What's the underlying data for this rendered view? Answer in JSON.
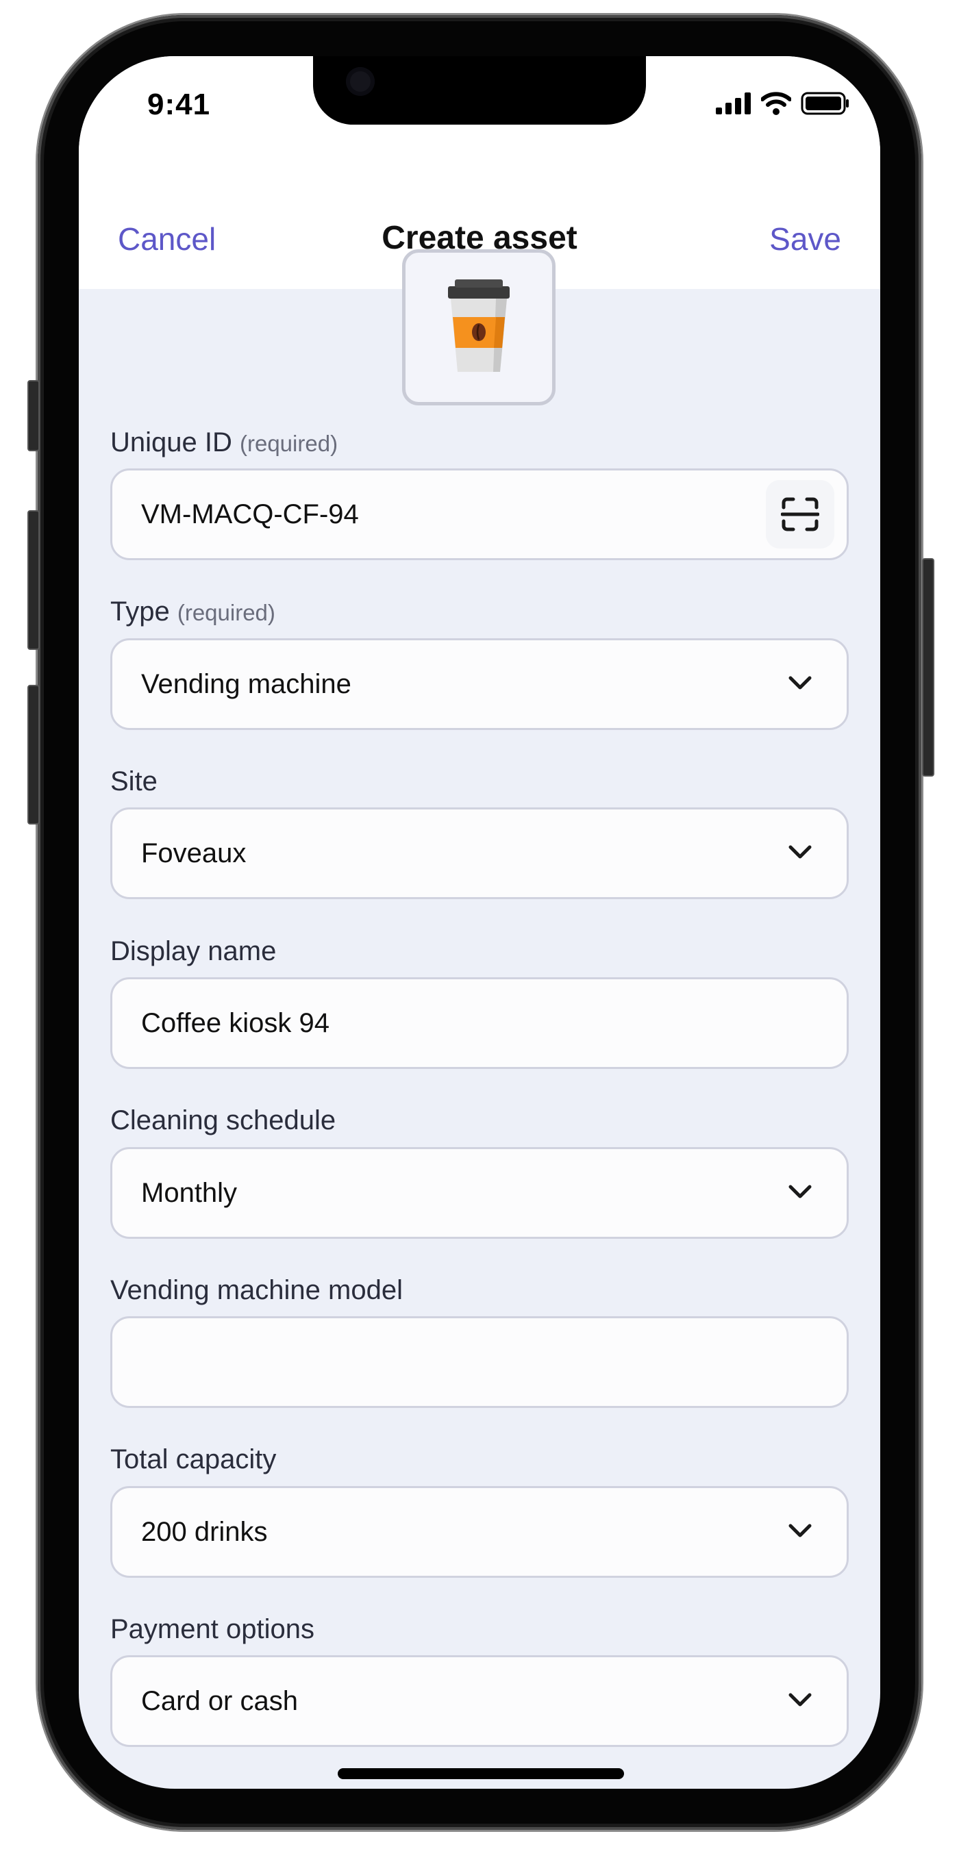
{
  "status_bar": {
    "time": "9:41"
  },
  "nav": {
    "cancel_label": "Cancel",
    "title": "Create asset",
    "save_label": "Save"
  },
  "asset_icon": "coffee-cup-icon",
  "fields": {
    "unique_id": {
      "label": "Unique ID",
      "hint": "(required)",
      "value": "VM-MACQ-CF-94"
    },
    "type": {
      "label": "Type",
      "hint": "(required)",
      "value": "Vending machine"
    },
    "site": {
      "label": "Site",
      "value": "Foveaux"
    },
    "display_name": {
      "label": "Display name",
      "value": "Coffee kiosk 94"
    },
    "cleaning_schedule": {
      "label": "Cleaning schedule",
      "value": "Monthly"
    },
    "vending_machine_model": {
      "label": "Vending machine model",
      "value": ""
    },
    "total_capacity": {
      "label": "Total capacity",
      "value": "200 drinks"
    },
    "payment_options": {
      "label": "Payment options",
      "value": "Card or cash"
    }
  },
  "colors": {
    "accent": "#5d57c8",
    "background": "#edf0f8",
    "field_border": "#d0d2df"
  }
}
